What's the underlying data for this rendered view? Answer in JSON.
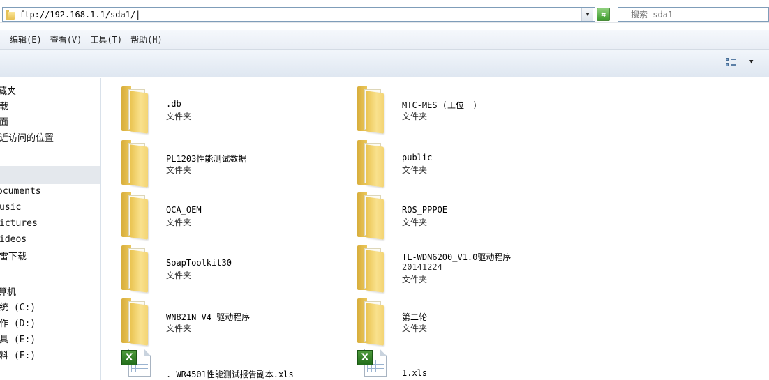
{
  "address": {
    "path": "ftp://192.168.1.1/sda1/|",
    "search_placeholder": "搜索 sda1"
  },
  "menu": [
    "编辑(E)",
    "查看(V)",
    "工具(T)",
    "帮助(H)"
  ],
  "nav": {
    "favorites": [
      "藏夹",
      "载",
      "面",
      "近访问的位置"
    ],
    "libraries": [
      "ocuments",
      "usic",
      "ictures",
      "ideos",
      "雷下载"
    ],
    "computer": [
      "算机",
      "统 (C:)",
      "作 (D:)",
      "具 (E:)",
      "料 (F:)"
    ]
  },
  "items": [
    {
      "name": ".db",
      "type": "文件夹",
      "kind": "folder"
    },
    {
      "name": "MTC-MES (工位一)",
      "type": "文件夹",
      "kind": "folder"
    },
    {
      "name": "PL1203性能测试数据",
      "type": "文件夹",
      "kind": "folder"
    },
    {
      "name": "public",
      "type": "文件夹",
      "kind": "folder"
    },
    {
      "name": "QCA_OEM",
      "type": "文件夹",
      "kind": "folder"
    },
    {
      "name": "ROS_PPPOE",
      "type": "文件夹",
      "kind": "folder"
    },
    {
      "name": "SoapToolkit30",
      "type": "文件夹",
      "kind": "folder"
    },
    {
      "name": "TL-WDN6200_V1.0驱动程序",
      "name2": "20141224",
      "type": "文件夹",
      "kind": "folder"
    },
    {
      "name": "WN821N V4 驱动程序",
      "type": "文件夹",
      "kind": "folder"
    },
    {
      "name": "第二轮",
      "type": "文件夹",
      "kind": "folder"
    },
    {
      "name": "._WR4501性能测试报告副本.xls",
      "kind": "xls"
    },
    {
      "name": "1.xls",
      "kind": "xls"
    }
  ],
  "icons": {
    "refresh": "refresh-icon",
    "search": "search-icon",
    "view": "view-options-icon"
  }
}
